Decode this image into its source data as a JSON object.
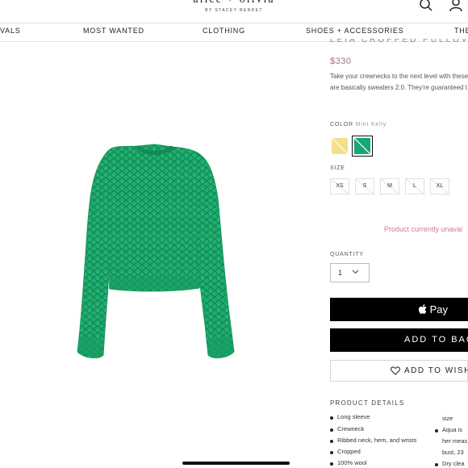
{
  "header": {
    "brand": "alice + olivia",
    "brand_sub": "BY STACEY BENDET",
    "icons": [
      "search-icon",
      "account-icon"
    ]
  },
  "nav": {
    "items": [
      {
        "label": "VALS"
      },
      {
        "label": "MOST WANTED"
      },
      {
        "label": "CLOTHING"
      },
      {
        "label": "SHOES + ACCESSORIES"
      },
      {
        "label": "THE"
      }
    ]
  },
  "product": {
    "name": "LEIA CROPPED PULLOVER",
    "price": "$330",
    "description": [
      "Take your crewnecks to the next level with these",
      "are basically sweaters 2.0. They're guaranteed t"
    ],
    "image": "green-cable-knit-cropped-sweater"
  },
  "color": {
    "label": "COLOR",
    "selected": "Mint Kelly",
    "swatches": [
      {
        "name": "yellow",
        "hex": "#f4e08a",
        "selected": false,
        "unavailable": true
      },
      {
        "name": "mint-kelly",
        "hex": "#17a776",
        "selected": true,
        "unavailable": true
      }
    ]
  },
  "size": {
    "label": "SIZE",
    "options": [
      "XS",
      "S",
      "M",
      "L",
      "XL"
    ]
  },
  "availability": "Product currently unavai",
  "quantity": {
    "label": "QUANTITY",
    "value": "1"
  },
  "buttons": {
    "apple_pay": "Pay",
    "add_to_bag": "ADD TO BAG",
    "wishlist": "ADD TO WISHLI"
  },
  "details": {
    "title": "PRODUCT DETAILS",
    "left": [
      "Long sleeve",
      "Crewneck",
      "Ribbed neck, hem, and wrists",
      "Cropped",
      "100% wool"
    ],
    "right": [
      "size",
      "Aqua is",
      "her meas",
      "bust, 23",
      "Dry clea"
    ]
  },
  "colors": {
    "accent_price": "#a0737a",
    "unavailable_text": "#c87d9a",
    "sweater": "#1fae6f"
  }
}
